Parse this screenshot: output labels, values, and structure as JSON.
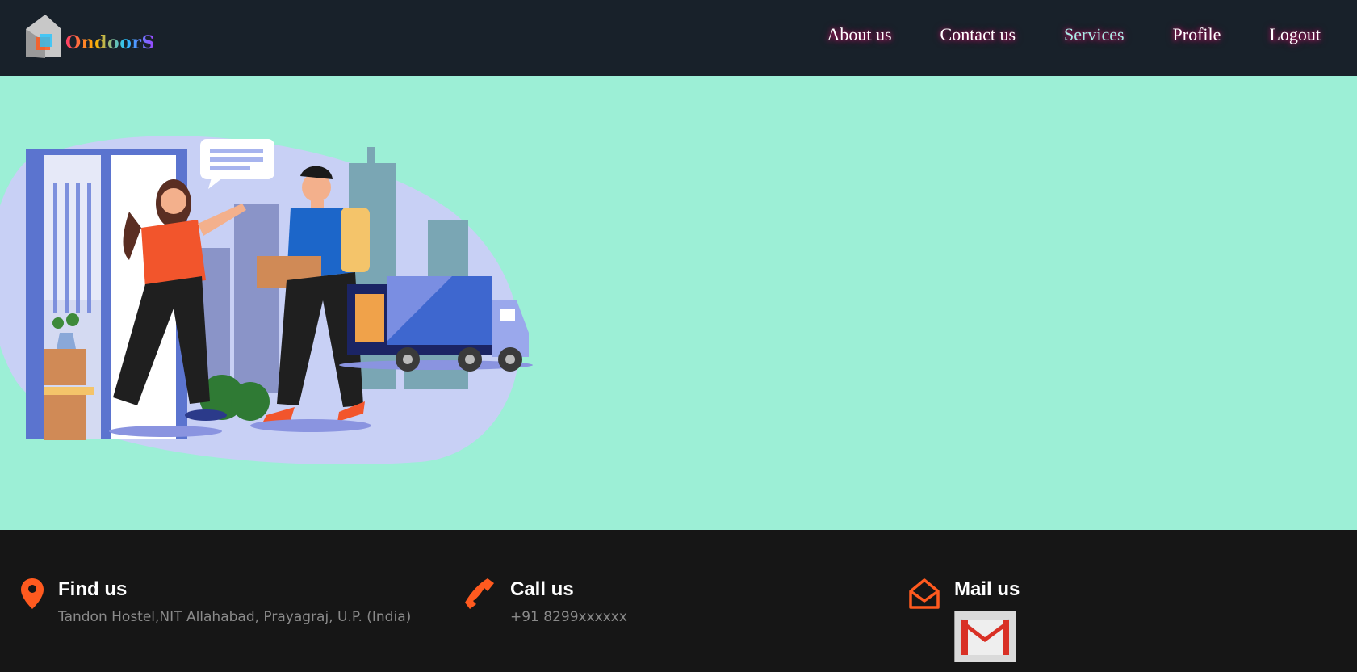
{
  "brand": {
    "name": "OndoorS"
  },
  "nav": {
    "links": [
      {
        "label": "About us",
        "active": false
      },
      {
        "label": "Contact us",
        "active": false
      },
      {
        "label": "Services",
        "active": true
      },
      {
        "label": "Profile",
        "active": false
      },
      {
        "label": "Logout",
        "active": false
      }
    ]
  },
  "colors": {
    "nav_bg": "#18212a",
    "hero_bg": "#9cefd6",
    "footer_bg": "#161616",
    "accent": "#ff5a1f"
  },
  "hero": {
    "illustration": "delivery-person-handing-package-illustration"
  },
  "footer": {
    "find": {
      "icon": "location-pin-icon",
      "title": "Find us",
      "text": "Tandon Hostel,NIT Allahabad, Prayagraj, U.P. (India)"
    },
    "call": {
      "icon": "phone-icon",
      "title": "Call us",
      "text": "+91 8299xxxxxx"
    },
    "mail": {
      "icon": "envelope-open-icon",
      "title": "Mail us",
      "link_icon": "gmail-icon"
    }
  }
}
